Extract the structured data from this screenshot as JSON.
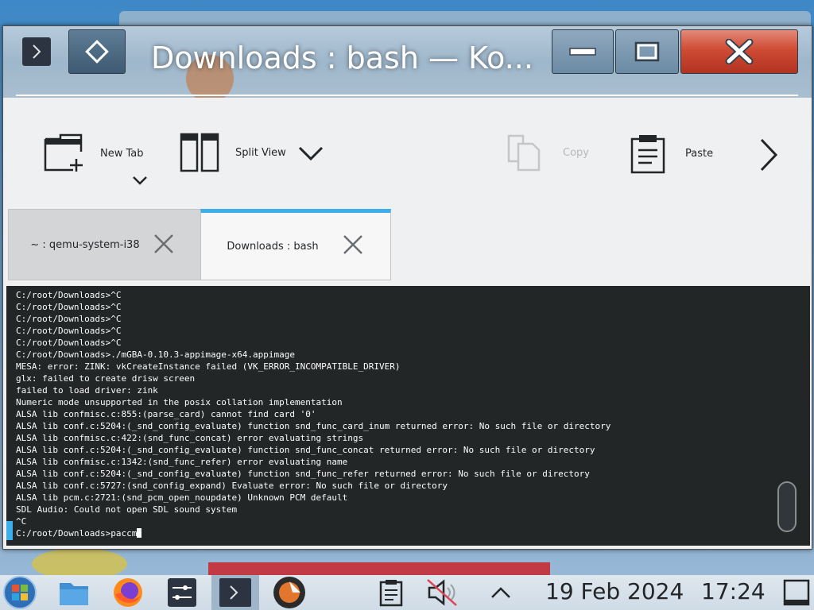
{
  "window": {
    "title": "Downloads : bash — Ko..."
  },
  "toolbar": {
    "new_tab_label": "New Tab",
    "split_view_label": "Split View",
    "copy_label": "Copy",
    "paste_label": "Paste"
  },
  "tabs": [
    {
      "label": "~ : qemu-system-i38",
      "active": false
    },
    {
      "label": "Downloads : bash",
      "active": true
    }
  ],
  "terminal": {
    "lines": [
      "C:/root/Downloads>^C",
      "C:/root/Downloads>^C",
      "C:/root/Downloads>^C",
      "C:/root/Downloads>^C",
      "C:/root/Downloads>^C",
      "C:/root/Downloads>./mGBA-0.10.3-appimage-x64.appimage",
      "MESA: error: ZINK: vkCreateInstance failed (VK_ERROR_INCOMPATIBLE_DRIVER)",
      "glx: failed to create drisw screen",
      "failed to load driver: zink",
      "Numeric mode unsupported in the posix collation implementation",
      "ALSA lib confmisc.c:855:(parse_card) cannot find card '0'",
      "ALSA lib conf.c:5204:(_snd_config_evaluate) function snd_func_card_inum returned error: No such file or directory",
      "ALSA lib confmisc.c:422:(snd_func_concat) error evaluating strings",
      "ALSA lib conf.c:5204:(_snd_config_evaluate) function snd_func_concat returned error: No such file or directory",
      "ALSA lib confmisc.c:1342:(snd_func_refer) error evaluating name",
      "ALSA lib conf.c:5204:(_snd_config_evaluate) function snd_func_refer returned error: No such file or directory",
      "ALSA lib conf.c:5727:(snd_config_expand) Evaluate error: No such file or directory",
      "ALSA lib pcm.c:2721:(snd_pcm_open_noupdate) Unknown PCM default",
      "SDL Audio: Could not open SDL sound system",
      "^C"
    ],
    "prompt": "C:/root/Downloads>",
    "input": "paccm"
  },
  "taskbar": {
    "date": "19 Feb 2024",
    "time": "17:24"
  },
  "colors": {
    "accent": "#3daee9",
    "terminal_bg": "#232627",
    "close_red": "#cf4b34"
  }
}
